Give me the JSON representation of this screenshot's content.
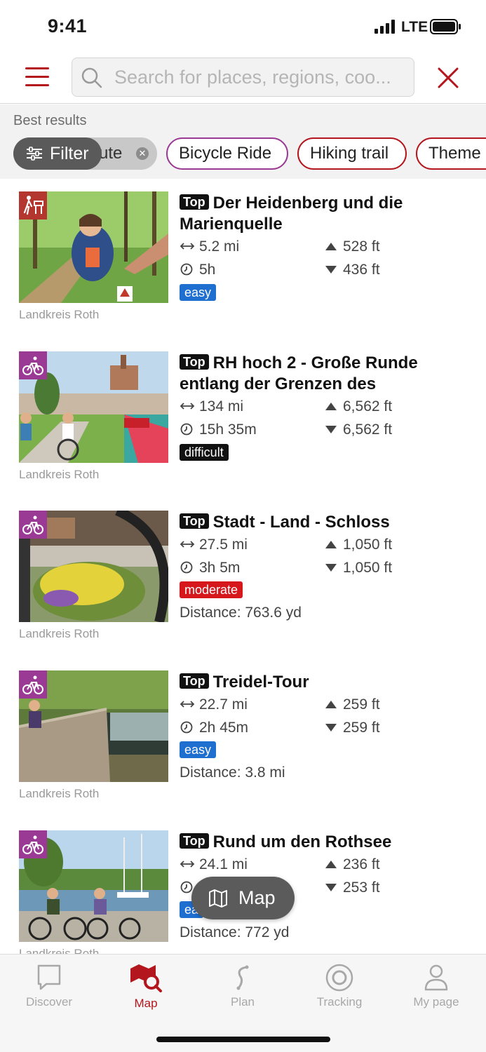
{
  "status_bar": {
    "time": "9:41",
    "network": "LTE"
  },
  "search": {
    "placeholder": "Search for places, regions, coo..."
  },
  "results": {
    "heading": "Best results",
    "filter_label": "Filter",
    "chips": [
      {
        "label": "Route",
        "visible_label": "ute",
        "active": true
      },
      {
        "label": "Bicycle Ride",
        "color": "#9a3a94"
      },
      {
        "label": "Hiking trail",
        "color": "#b3161c"
      },
      {
        "label": "Theme",
        "color": "#b3161c"
      }
    ]
  },
  "tours": [
    {
      "top_label": "Top",
      "title": "Der Heidenberg und die Marienquelle",
      "distance": "5.2 mi",
      "duration": "5h",
      "ascent": "528 ft",
      "descent": "436 ft",
      "difficulty": "easy",
      "source": "Landkreis Roth",
      "category_icon": "hiking-icon",
      "category_color": "#b3362f"
    },
    {
      "top_label": "Top",
      "title": "RH hoch 2 - Große Runde entlang der Grenzen des",
      "distance": "134 mi",
      "duration": "15h 35m",
      "ascent": "6,562 ft",
      "descent": "6,562 ft",
      "difficulty": "difficult",
      "source": "Landkreis Roth",
      "category_icon": "bicycle-icon",
      "category_color": "#9a3a94"
    },
    {
      "top_label": "Top",
      "title": "Stadt - Land - Schloss",
      "distance": "27.5 mi",
      "duration": "3h 5m",
      "ascent": "1,050 ft",
      "descent": "1,050 ft",
      "difficulty": "moderate",
      "distance_from": "Distance: 763.6 yd",
      "source": "Landkreis Roth",
      "category_icon": "bicycle-icon",
      "category_color": "#9a3a94"
    },
    {
      "top_label": "Top",
      "title": "Treidel-Tour",
      "distance": "22.7 mi",
      "duration": "2h 45m",
      "ascent": "259 ft",
      "descent": "259 ft",
      "difficulty": "easy",
      "distance_from": "Distance: 3.8 mi",
      "source": "Landkreis Roth",
      "category_icon": "bicycle-icon",
      "category_color": "#9a3a94"
    },
    {
      "top_label": "Top",
      "title": "Rund um den Rothsee",
      "distance": "24.1 mi",
      "duration": "",
      "ascent": "236 ft",
      "descent": "253 ft",
      "difficulty": "ea",
      "distance_from": "Distance: 772 yd",
      "source": "Landkreis Roth",
      "category_icon": "bicycle-icon",
      "category_color": "#9a3a94"
    }
  ],
  "map_button": {
    "label": "Map"
  },
  "tabs": [
    {
      "label": "Discover",
      "icon": "discover-icon",
      "active": false
    },
    {
      "label": "Map",
      "icon": "map-search-icon",
      "active": true
    },
    {
      "label": "Plan",
      "icon": "plan-icon",
      "active": false
    },
    {
      "label": "Tracking",
      "icon": "tracking-icon",
      "active": false
    },
    {
      "label": "My page",
      "icon": "user-icon",
      "active": false
    }
  ],
  "colors": {
    "accent": "#b3161c",
    "bike": "#9a3a94",
    "easy": "#1e6fd0",
    "moderate": "#d6171c",
    "difficult": "#111111"
  }
}
